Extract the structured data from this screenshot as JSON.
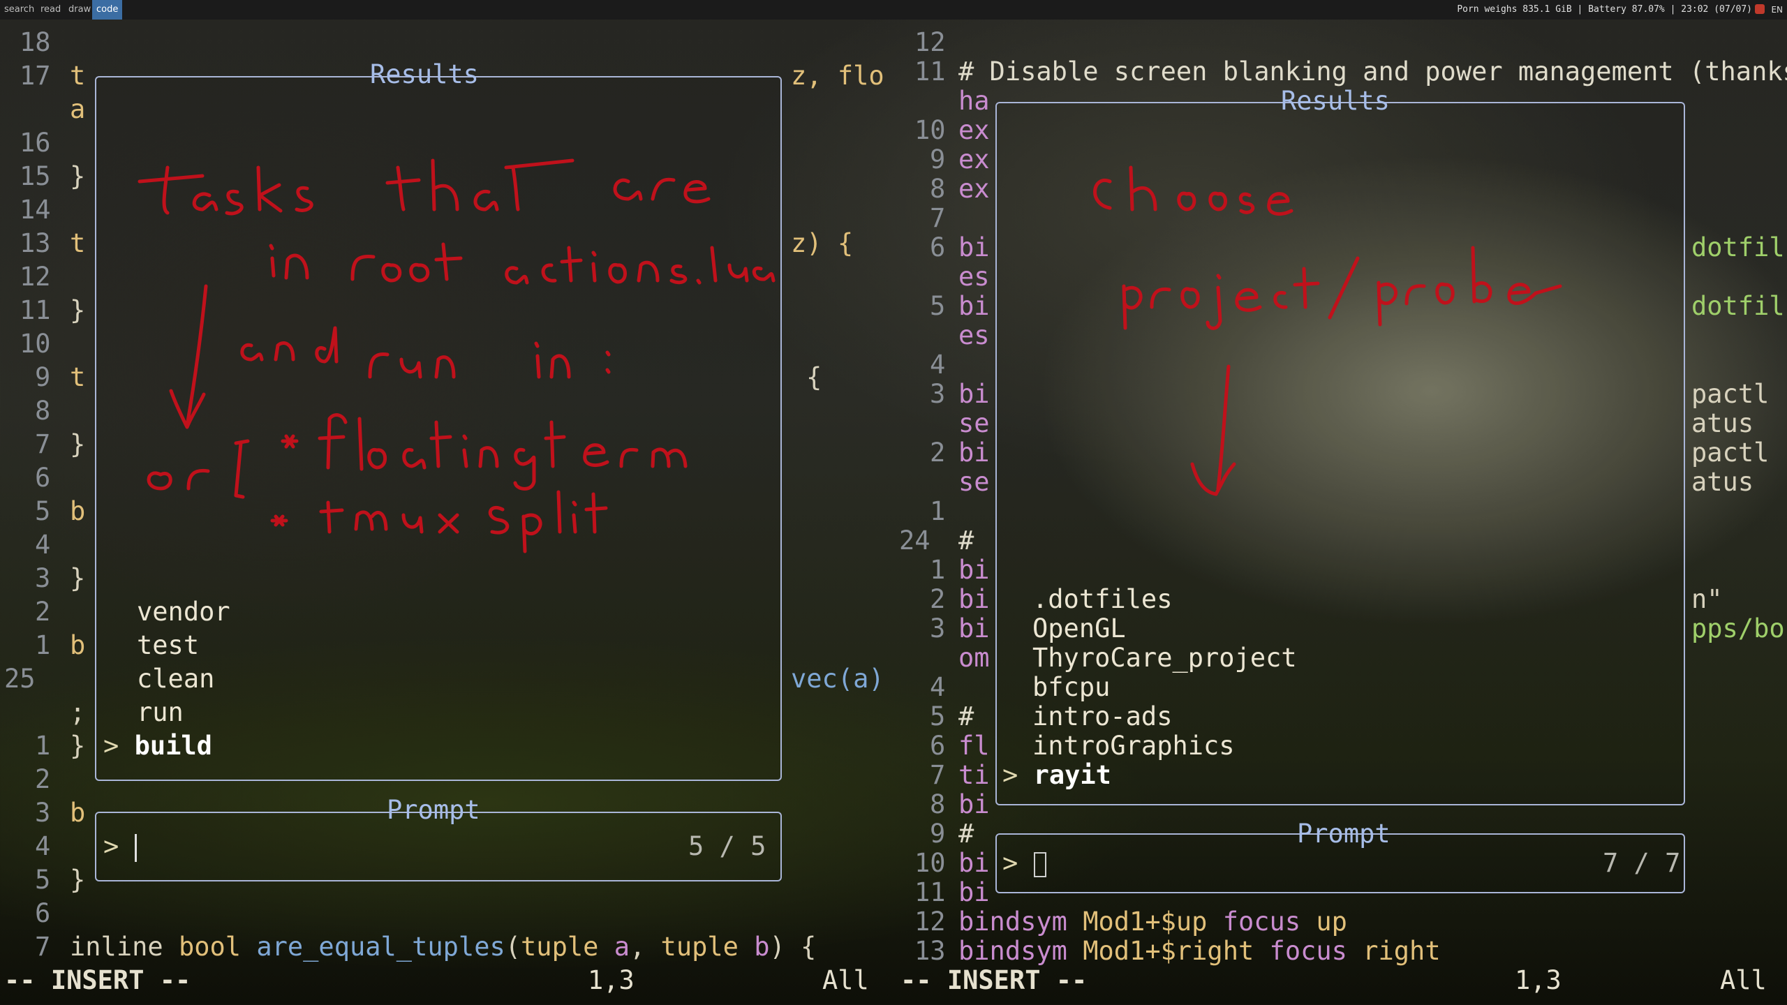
{
  "workspaces": [
    "search",
    "read",
    "draw",
    "code"
  ],
  "active_workspace": "code",
  "status": {
    "disk": "Porn weighs 835.1 GiB",
    "battery": "Battery 87.07%",
    "clock": "23:02 (07/07)",
    "lang": "EN"
  },
  "left": {
    "line_numbers": [
      "18",
      "17",
      "",
      "16",
      "15",
      "14",
      "13",
      "12",
      "11",
      "10",
      "9",
      "8",
      "7",
      "6",
      "5",
      "4",
      "3",
      "2",
      "1",
      "25",
      "",
      "1",
      "2",
      "3",
      "4",
      "5",
      "6",
      "7"
    ],
    "gutter_text": [
      "",
      "t",
      "a",
      "",
      "}",
      "",
      "t",
      "",
      "}",
      "",
      "t",
      "",
      "}",
      "",
      "b",
      "",
      "}",
      "",
      "b",
      "",
      ";",
      "}",
      "",
      "b",
      "",
      "}",
      "",
      ""
    ],
    "right_fragments": {
      "r1": "z, flo",
      "r2": "z) {",
      "r3": "{",
      "r4": "vec(a)"
    },
    "last_line": {
      "kw": "inline",
      "ty": "bool",
      "fn": "are_equal_tuples",
      "rest1": "(",
      "t1": "tuple",
      "a": "a",
      ", ": ", ",
      "t2": "tuple",
      "b": "b",
      "end": ") {"
    },
    "results_title": "Results",
    "results": [
      "vendor",
      "test",
      "clean",
      "run"
    ],
    "selected": "build",
    "prompt_title": "Prompt",
    "prompt_symbol": ">",
    "count": "5 / 5",
    "mode": "-- INSERT --",
    "pos": "1,3",
    "scroll": "All"
  },
  "right": {
    "line_numbers": [
      "12",
      "11",
      "",
      "10",
      "9",
      "8",
      "7",
      "6",
      "",
      "5",
      "",
      "4",
      "3",
      "",
      "2",
      "",
      "1",
      "24",
      "1",
      "2",
      "3",
      "",
      "4",
      "5",
      "6",
      "7",
      "8",
      "9",
      "10",
      "11",
      "12",
      "13"
    ],
    "comment_line": "# Disable screen blanking and power management (thanks C",
    "gutter_text": [
      "",
      "ha",
      "ex",
      "ex",
      "ex",
      "",
      "bi",
      "es",
      "bi",
      "es",
      "",
      "bi",
      "se",
      "bi",
      "se",
      "",
      "#",
      "bi",
      "bi",
      "bi",
      "om",
      "#",
      "fl",
      "ti",
      "bi",
      "#",
      "bi",
      "bi"
    ],
    "right_fragments": [
      "dotfil",
      "dotfil",
      "pactl",
      "atus",
      "pactl",
      "atus",
      "n\"",
      "pps/bo"
    ],
    "line12": {
      "k": "bindsym",
      "a": "Mod1+$up",
      "c": "focus",
      "d": "up"
    },
    "line13": {
      "k": "bindsym",
      "a": "Mod1+$right",
      "c": "focus",
      "d": "right"
    },
    "results_title": "Results",
    "results": [
      ".dotfiles",
      "OpenGL",
      "ThyroCare_project",
      "bfcpu",
      "intro-ads",
      "introGraphics"
    ],
    "selected": "rayit",
    "prompt_title": "Prompt",
    "prompt_symbol": ">",
    "count": "7 / 7",
    "mode": "-- INSERT --",
    "pos": "1,3",
    "scroll": "All"
  },
  "annotations": {
    "left_note": "tasks that are in root actions.lua and run in: or [ * floatingterm * tmux split",
    "right_note": "choose project/probe"
  }
}
